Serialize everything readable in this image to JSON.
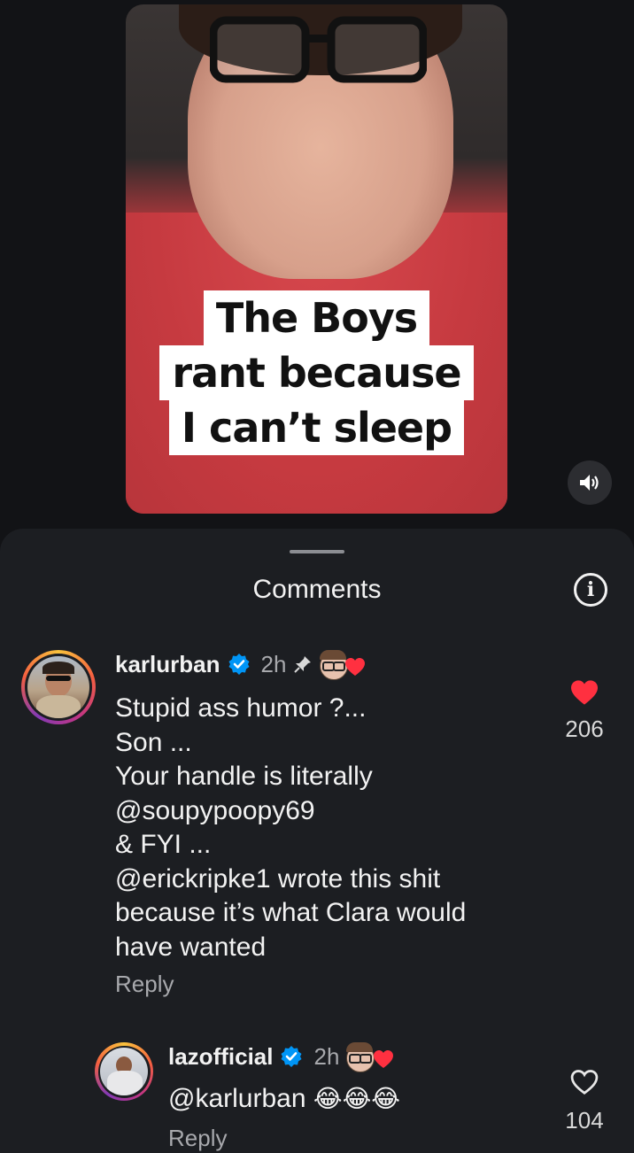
{
  "video": {
    "caption_lines": [
      "The Boys",
      "rant because",
      "I can’t sleep"
    ],
    "sound_icon": "speaker-icon"
  },
  "comments_panel": {
    "title": "Comments",
    "info_icon": "info-icon"
  },
  "comments": [
    {
      "username": "karlurban",
      "verified": true,
      "time": "2h",
      "pinned": true,
      "creator_liked": true,
      "lines": [
        "Stupid ass humor ?...",
        "Son ...",
        "Your handle is literally",
        "@soupypoopy69",
        "& FYI ...",
        "@erickripke1 wrote this shit",
        "because it’s what Clara would",
        "have wanted"
      ],
      "reply_label": "Reply",
      "likes": "206",
      "liked": true,
      "like_color": "#ff3040"
    },
    {
      "username": "lazofficial",
      "verified": true,
      "time": "2h",
      "creator_liked": true,
      "mention": "@karlurban",
      "emoji": "😂😂😂",
      "reply_label": "Reply",
      "likes": "104",
      "liked": false
    }
  ],
  "colors": {
    "background": "#121316",
    "sheet": "#1c1e22",
    "verified_blue": "#0095f6",
    "like_red": "#ff3040"
  }
}
